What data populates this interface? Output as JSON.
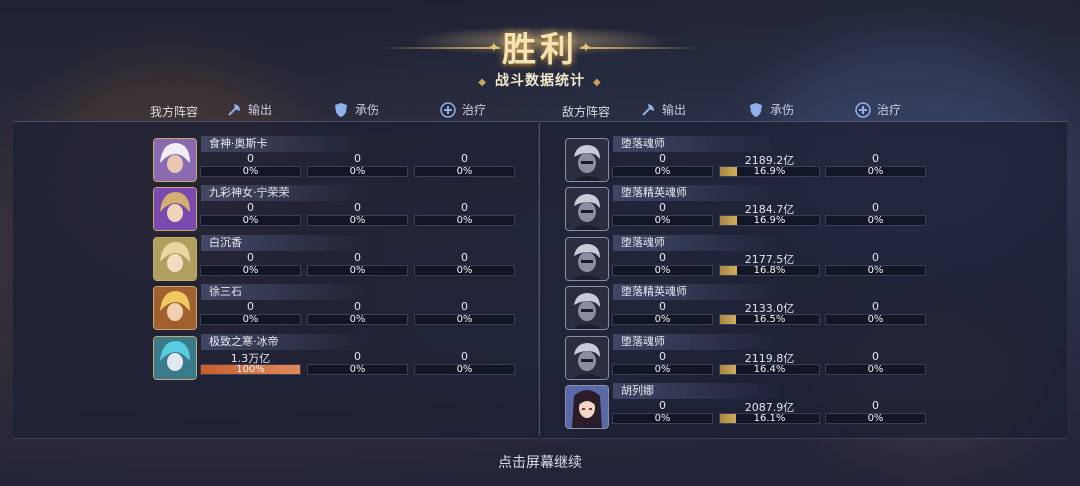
{
  "title": "胜利",
  "subtitle": "战斗数据统计",
  "headers": {
    "ally_team": "我方阵容",
    "enemy_team": "敌方阵容",
    "output": "输出",
    "tank": "承伤",
    "heal": "治疗"
  },
  "colors": {
    "accent_gold": "#d1ad5e",
    "ally_output_bar": "#d2703f",
    "panel": "#1c2034"
  },
  "allies": [
    {
      "name": "食神·奥斯卡",
      "output": "0",
      "output_pct": "0%",
      "output_fill": 0,
      "tank": "0",
      "tank_pct": "0%",
      "tank_fill": 0,
      "heal": "0",
      "heal_pct": "0%",
      "heal_fill": 0
    },
    {
      "name": "九彩神女·宁荣荣",
      "output": "0",
      "output_pct": "0%",
      "output_fill": 0,
      "tank": "0",
      "tank_pct": "0%",
      "tank_fill": 0,
      "heal": "0",
      "heal_pct": "0%",
      "heal_fill": 0
    },
    {
      "name": "白沉香",
      "output": "0",
      "output_pct": "0%",
      "output_fill": 0,
      "tank": "0",
      "tank_pct": "0%",
      "tank_fill": 0,
      "heal": "0",
      "heal_pct": "0%",
      "heal_fill": 0
    },
    {
      "name": "徐三石",
      "output": "0",
      "output_pct": "0%",
      "output_fill": 0,
      "tank": "0",
      "tank_pct": "0%",
      "tank_fill": 0,
      "heal": "0",
      "heal_pct": "0%",
      "heal_fill": 0
    },
    {
      "name": "极致之寒·冰帝",
      "output": "1.3万亿",
      "output_pct": "100%",
      "output_fill": 1.0,
      "tank": "0",
      "tank_pct": "0%",
      "tank_fill": 0,
      "heal": "0",
      "heal_pct": "0%",
      "heal_fill": 0
    }
  ],
  "enemies": [
    {
      "name": "堕落魂师",
      "output": "0",
      "output_pct": "0%",
      "output_fill": 0,
      "tank": "2189.2亿",
      "tank_pct": "16.9%",
      "tank_fill": 0.169,
      "heal": "0",
      "heal_pct": "0%",
      "heal_fill": 0
    },
    {
      "name": "堕落精英魂师",
      "output": "0",
      "output_pct": "0%",
      "output_fill": 0,
      "tank": "2184.7亿",
      "tank_pct": "16.9%",
      "tank_fill": 0.169,
      "heal": "0",
      "heal_pct": "0%",
      "heal_fill": 0
    },
    {
      "name": "堕落魂师",
      "output": "0",
      "output_pct": "0%",
      "output_fill": 0,
      "tank": "2177.5亿",
      "tank_pct": "16.8%",
      "tank_fill": 0.168,
      "heal": "0",
      "heal_pct": "0%",
      "heal_fill": 0
    },
    {
      "name": "堕落精英魂师",
      "output": "0",
      "output_pct": "0%",
      "output_fill": 0,
      "tank": "2133.0亿",
      "tank_pct": "16.5%",
      "tank_fill": 0.165,
      "heal": "0",
      "heal_pct": "0%",
      "heal_fill": 0
    },
    {
      "name": "堕落魂师",
      "output": "0",
      "output_pct": "0%",
      "output_fill": 0,
      "tank": "2119.8亿",
      "tank_pct": "16.4%",
      "tank_fill": 0.164,
      "heal": "0",
      "heal_pct": "0%",
      "heal_fill": 0
    },
    {
      "name": "胡列娜",
      "output": "0",
      "output_pct": "0%",
      "output_fill": 0,
      "tank": "2087.9亿",
      "tank_pct": "16.1%",
      "tank_fill": 0.161,
      "heal": "0",
      "heal_pct": "0%",
      "heal_fill": 0
    }
  ],
  "footer": "点击屏幕继续"
}
